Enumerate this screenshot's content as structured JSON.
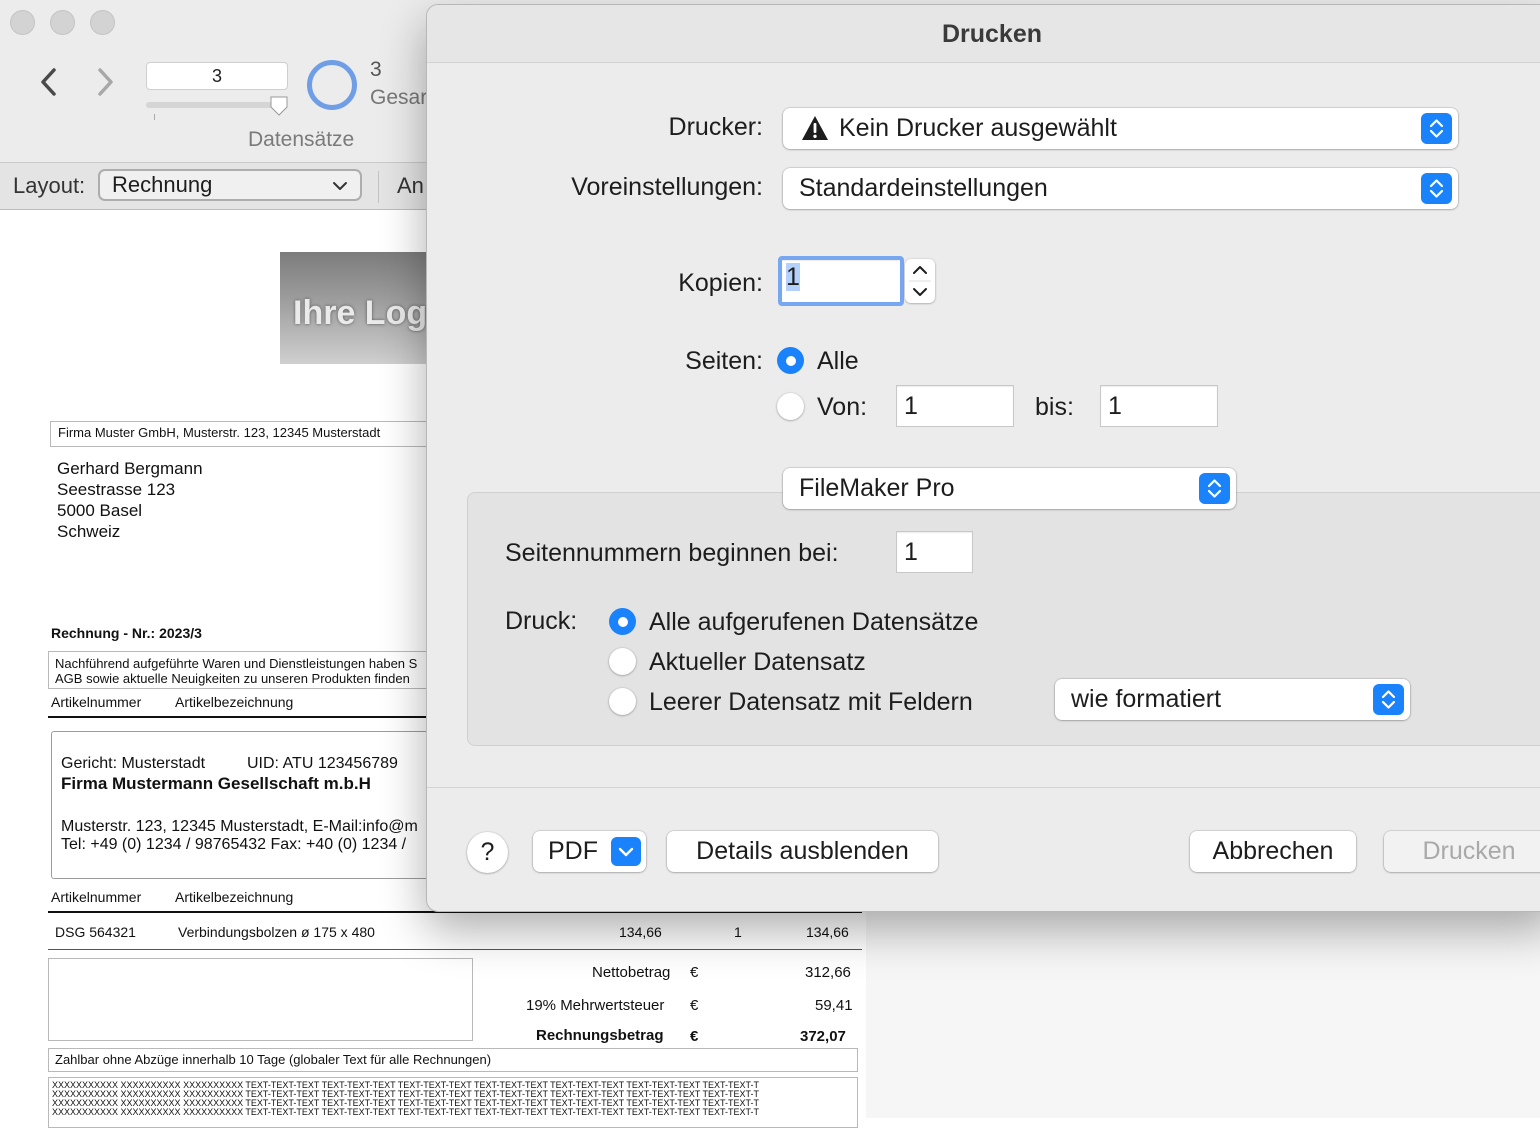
{
  "toolbar": {
    "record_current": "3",
    "records_label": "Datensätze",
    "found_count": "3",
    "found_label": "Gesar"
  },
  "layoutbar": {
    "label": "Layout:",
    "selected_layout": "Rechnung",
    "truncated_item": "An"
  },
  "document": {
    "logo_text": "Ihre Log",
    "sender_line": "Firma Muster GmbH, Musterstr. 123, 12345 Musterstadt",
    "recipient": [
      "Gerhard Bergmann",
      "Seestrasse 123",
      "5000 Basel",
      "Schweiz"
    ],
    "invoice_title": "Rechnung - Nr.: 2023/3",
    "intro_line1": "Nachführend aufgeführte Waren und Dienstleistungen haben S",
    "intro_line2": "AGB sowie aktuelle Neuigkeiten zu unseren Produkten finden",
    "col_artikelnummer": "Artikelnummer",
    "col_artikelbezeichnung": "Artikelbezeichnung",
    "footer_court": "Gericht: Musterstadt",
    "footer_uid": "UID: ATU 123456789",
    "footer_company": "Firma Mustermann Gesellschaft m.b.H",
    "footer_address": "Musterstr. 123, 12345 Musterstadt, E-Mail:info@m",
    "footer_phone": "Tel: +49 (0) 1234 / 98765432 Fax: +40 (0) 1234 / ",
    "line_item": {
      "number": "DSG 564321",
      "description": "Verbindungsbolzen ø 175 x 480",
      "unit_price": "134,66",
      "quantity": "1",
      "total": "134,66"
    },
    "totals": {
      "net_label": "Nettobetrag",
      "net_currency": "€",
      "net_value": "312,66",
      "vat_label": "19% Mehrwertsteuer",
      "vat_currency": "€",
      "vat_value": "59,41",
      "gross_label": "Rechnungsbetrag",
      "gross_currency": "€",
      "gross_value": "372,07"
    },
    "payment_terms": "Zahlbar ohne Abzüge innerhalb 10 Tage (globaler Text für alle Rechnungen)",
    "filler_row": "XXXXXXXXXXX  XXXXXXXXXX  XXXXXXXXXX  TEXT-TEXT-TEXT  TEXT-TEXT-TEXT  TEXT-TEXT-TEXT  TEXT-TEXT-TEXT  TEXT-TEXT-TEXT  TEXT-TEXT-TEXT  TEXT-TEXT-T"
  },
  "dialog": {
    "title": "Drucken",
    "printer_label": "Drucker:",
    "printer_value": "Kein Drucker ausgewählt",
    "presets_label": "Voreinstellungen:",
    "presets_value": "Standardeinstellungen",
    "copies_label": "Kopien:",
    "copies_value": "1",
    "pages_label": "Seiten:",
    "pages_all": "Alle",
    "pages_from": "Von:",
    "pages_from_value": "1",
    "pages_to": "bis:",
    "pages_to_value": "1",
    "section_popup": "FileMaker Pro",
    "page_number_start_label": "Seitennummern beginnen bei:",
    "page_number_start_value": "1",
    "print_label": "Druck:",
    "print_option_all": "Alle aufgerufenen Datensätze",
    "print_option_current": "Aktueller Datensatz",
    "print_option_blank": "Leerer Datensatz mit Feldern",
    "blank_format_value": "wie formatiert",
    "help": "?",
    "pdf": "PDF",
    "hide_details": "Details ausblenden",
    "cancel": "Abbrechen",
    "print": "Drucken"
  },
  "colors": {
    "accent": "#1a82fb",
    "focus_ring": "#78a7f2",
    "dialog_bg": "#ececec",
    "progress_ring": "#6f9ee6"
  }
}
